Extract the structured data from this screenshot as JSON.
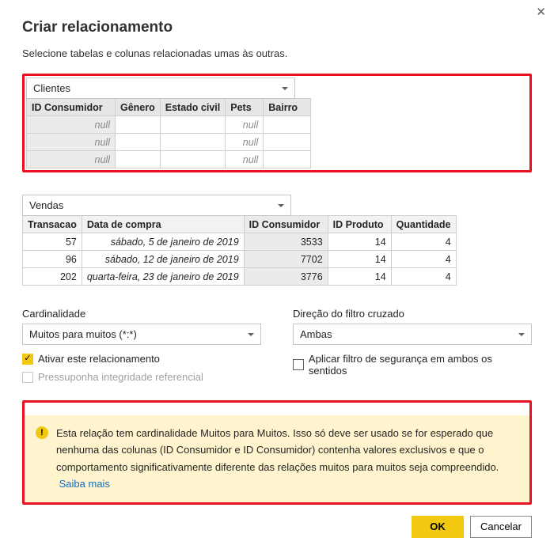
{
  "header": {
    "title": "Criar relacionamento",
    "subtitle": "Selecione tabelas e colunas relacionadas umas às outras."
  },
  "table1": {
    "name": "Clientes",
    "columns": [
      "ID Consumidor",
      "Gênero",
      "Estado civil",
      "Pets",
      "Bairro"
    ],
    "rows": [
      {
        "c0": "null",
        "c1": "",
        "c2": "",
        "c3": "null",
        "c4": ""
      },
      {
        "c0": "null",
        "c1": "",
        "c2": "",
        "c3": "null",
        "c4": ""
      },
      {
        "c0": "null",
        "c1": "",
        "c2": "",
        "c3": "null",
        "c4": ""
      }
    ]
  },
  "table2": {
    "name": "Vendas",
    "columns": [
      "Transacao",
      "Data de compra",
      "ID Consumidor",
      "ID Produto",
      "Quantidade"
    ],
    "rows": [
      {
        "c0": "57",
        "c1": "sábado, 5 de janeiro de 2019",
        "c2": "3533",
        "c3": "14",
        "c4": "4"
      },
      {
        "c0": "96",
        "c1": "sábado, 12 de janeiro de 2019",
        "c2": "7702",
        "c3": "14",
        "c4": "4"
      },
      {
        "c0": "202",
        "c1": "quarta-feira, 23 de janeiro de 2019",
        "c2": "3776",
        "c3": "14",
        "c4": "4"
      }
    ]
  },
  "options": {
    "cardinality_label": "Cardinalidade",
    "cardinality_value": "Muitos para muitos (*:*)",
    "crossfilter_label": "Direção do filtro cruzado",
    "crossfilter_value": "Ambas",
    "activate_label": "Ativar este relacionamento",
    "security_label": "Aplicar filtro de segurança em ambos os sentidos",
    "referential_label": "Pressuponha integridade referencial"
  },
  "warning": {
    "text": "Esta relação tem cardinalidade Muitos para Muitos. Isso só deve ser usado se for esperado que nenhuma das colunas (ID Consumidor e ID Consumidor) contenha valores exclusivos e que o comportamento significativamente diferente das relações muitos para muitos seja compreendido.",
    "link": "Saiba mais"
  },
  "footer": {
    "ok": "OK",
    "cancel": "Cancelar"
  }
}
